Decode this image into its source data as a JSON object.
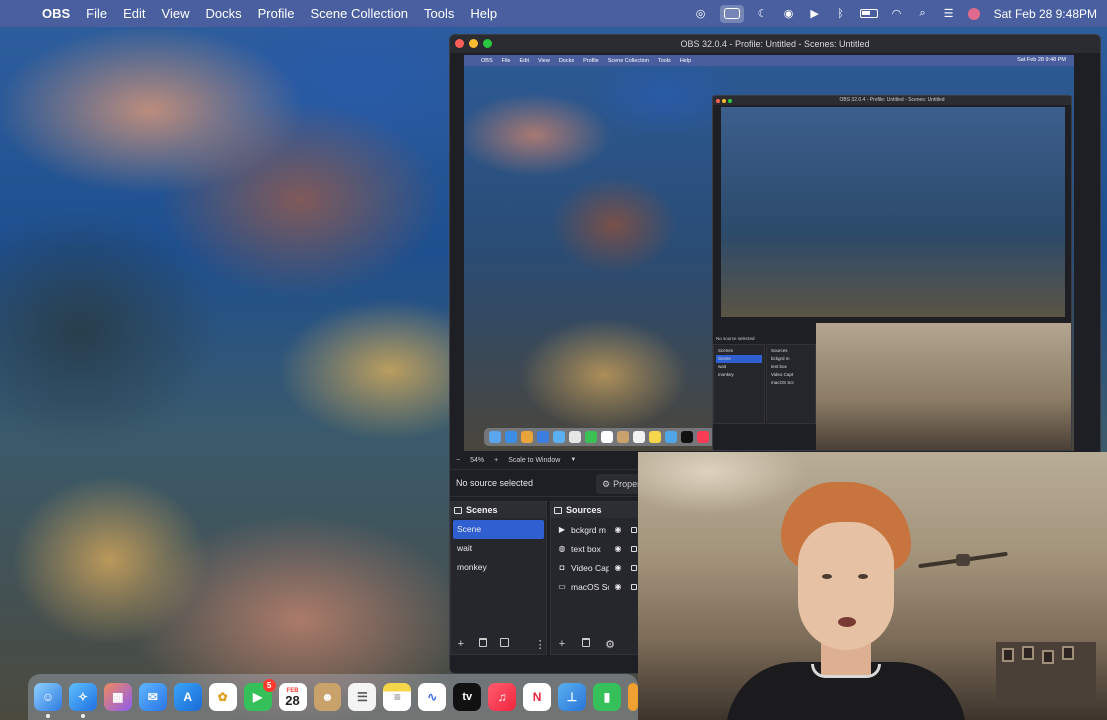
{
  "menubar": {
    "app_name": "OBS",
    "items": [
      "File",
      "Edit",
      "View",
      "Docks",
      "Profile",
      "Scene Collection",
      "Tools",
      "Help"
    ],
    "clock": "Sat Feb 28  9:48PM"
  },
  "obs": {
    "title": "OBS 32.0.4 - Profile: Untitled - Scenes: Untitled",
    "preview_toolbar": {
      "zoom_minus": "−",
      "zoom": "54%",
      "zoom_plus": "+",
      "scale_mode": "Scale to Window"
    },
    "context": {
      "no_source": "No source selected",
      "properties_label": "Properties"
    },
    "scenes_dock": {
      "title": "Scenes",
      "items": [
        "Scene",
        "wait",
        "monkey"
      ],
      "selected": "Scene"
    },
    "sources_dock": {
      "title": "Sources",
      "items": [
        {
          "name": "bckgrd m",
          "type_icon": "play-icon"
        },
        {
          "name": "text box",
          "type_icon": "text-icon"
        },
        {
          "name": "Video Capt",
          "type_icon": "camera-icon"
        },
        {
          "name": "macOS Scr",
          "type_icon": "monitor-icon"
        }
      ]
    },
    "nested": {
      "menu_items": [
        "OBS",
        "File",
        "Edit",
        "View",
        "Docks",
        "Profile",
        "Scene Collection",
        "Tools",
        "Help"
      ],
      "clock": "Sat Feb 28  9:48 PM",
      "inner_title": "OBS 32.0.4 - Profile: Untitled - Scenes: Untitled",
      "no_source": "No source selected",
      "scenes_title": "Scenes",
      "sources_title": "Sources",
      "scenes": [
        "Scene",
        "wait",
        "monkey"
      ],
      "sources": [
        "bckgrd m",
        "text box",
        "Video Capt",
        "macOS Scr"
      ]
    }
  },
  "dock": {
    "facetime_badge": "5",
    "calendar_month": "FEB",
    "calendar_day": "28",
    "tv_label": "tv"
  },
  "colors": {
    "selection": "#2f5fd0",
    "obs_bg": "#1e1f24",
    "menubar": "#5460a0"
  }
}
